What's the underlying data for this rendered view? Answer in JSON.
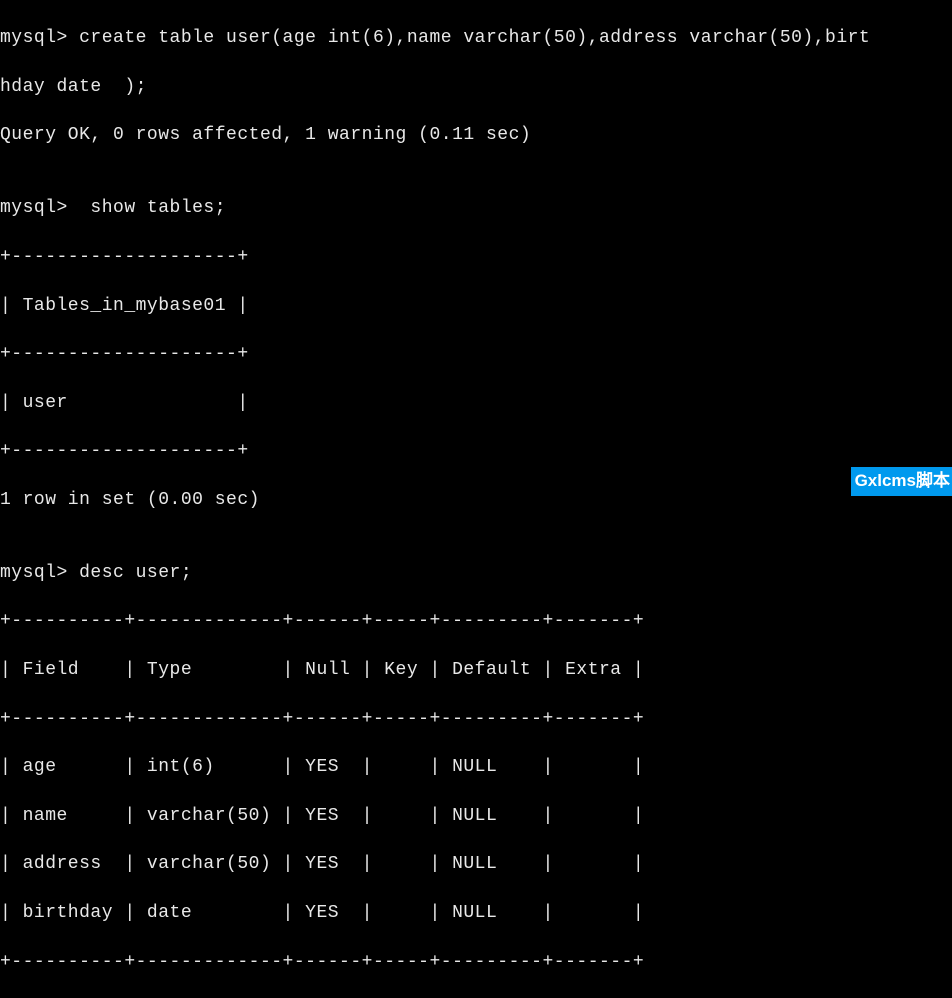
{
  "terminal": {
    "prompt": "mysql>",
    "commands": {
      "create_line1": "mysql> create table user(age int(6),name varchar(50),address varchar(50),birt",
      "create_line2": "hday date  );",
      "create_result": "Query OK, 0 rows affected, 1 warning (0.11 sec)",
      "blank1": "",
      "show_tables_cmd": "mysql>  show tables;",
      "tables_border_top": "+--------------------+",
      "tables_header": "| Tables_in_mybase01 |",
      "tables_border_mid": "+--------------------+",
      "tables_row": "| user               |",
      "tables_border_bot": "+--------------------+",
      "show_result": "1 row in set (0.00 sec)",
      "blank2": "",
      "desc_cmd": "mysql> desc user;",
      "desc_border_top": "+----------+-------------+------+-----+---------+-------+",
      "desc_header": "| Field    | Type        | Null | Key | Default | Extra |",
      "desc_border_mid": "+----------+-------------+------+-----+---------+-------+",
      "desc_row1": "| age      | int(6)      | YES  |     | NULL    |       |",
      "desc_row2": "| name     | varchar(50) | YES  |     | NULL    |       |",
      "desc_row3": "| address  | varchar(50) | YES  |     | NULL    |       |",
      "desc_row4": "| birthday | date        | YES  |     | NULL    |       |",
      "desc_border_bot": "+----------+-------------+------+-----+---------+-------+"
    }
  },
  "watermark": "Gxlcms脚本",
  "chart_data": {
    "type": "table",
    "tables": [
      {
        "title": "show tables",
        "columns": [
          "Tables_in_mybase01"
        ],
        "rows": [
          [
            "user"
          ]
        ],
        "footer": "1 row in set (0.00 sec)"
      },
      {
        "title": "desc user",
        "columns": [
          "Field",
          "Type",
          "Null",
          "Key",
          "Default",
          "Extra"
        ],
        "rows": [
          [
            "age",
            "int(6)",
            "YES",
            "",
            "NULL",
            ""
          ],
          [
            "name",
            "varchar(50)",
            "YES",
            "",
            "NULL",
            ""
          ],
          [
            "address",
            "varchar(50)",
            "YES",
            "",
            "NULL",
            ""
          ],
          [
            "birthday",
            "date",
            "YES",
            "",
            "NULL",
            ""
          ]
        ]
      }
    ],
    "query_result": "Query OK, 0 rows affected, 1 warning (0.11 sec)"
  }
}
